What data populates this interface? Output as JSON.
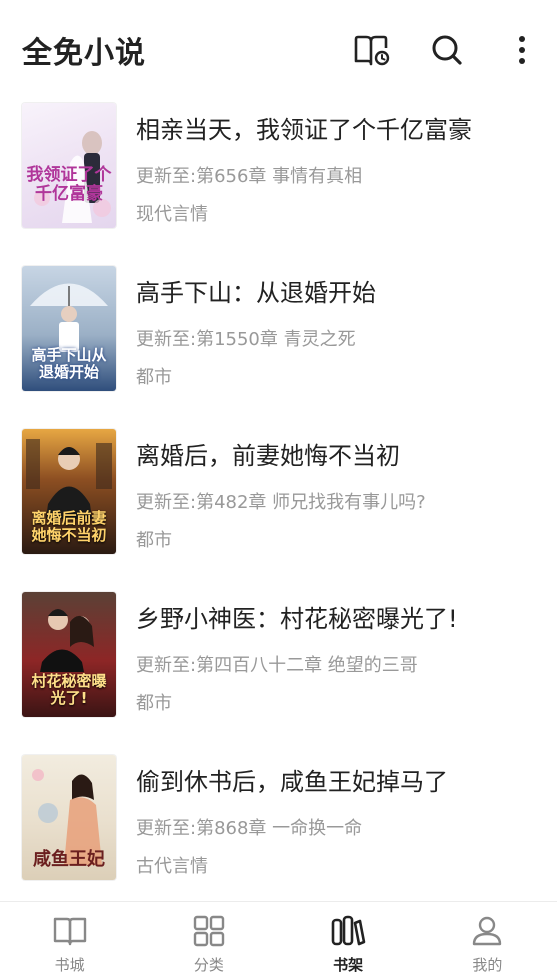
{
  "app": {
    "title": "全免小说"
  },
  "header_icons": [
    "bookshelf-history-icon",
    "search-icon",
    "more-vertical-icon"
  ],
  "books": [
    {
      "title": "相亲当天，我领证了个千亿富豪",
      "update": "更新至:第656章 事情有真相",
      "genre": "现代言情",
      "cover_text": "我领证了个千亿富豪"
    },
    {
      "title": "高手下山：从退婚开始",
      "update": "更新至:第1550章 青灵之死",
      "genre": "都市",
      "cover_text": "高手下山从退婚开始"
    },
    {
      "title": "离婚后，前妻她悔不当初",
      "update": "更新至:第482章 师兄找我有事儿吗?",
      "genre": "都市",
      "cover_text": "离婚后前妻她悔不当初"
    },
    {
      "title": "乡野小神医：村花秘密曝光了!",
      "update": "更新至:第四百八十二章 绝望的三哥",
      "genre": "都市",
      "cover_text": "村花秘密曝光了!"
    },
    {
      "title": "偷到休书后，咸鱼王妃掉马了",
      "update": "更新至:第868章 一命换一命",
      "genre": "古代言情",
      "cover_text": "咸鱼王妃"
    }
  ],
  "tabs": [
    {
      "label": "书城",
      "icon": "book-open-icon",
      "active": false
    },
    {
      "label": "分类",
      "icon": "grid-icon",
      "active": false
    },
    {
      "label": "书架",
      "icon": "bookshelf-icon",
      "active": true
    },
    {
      "label": "我的",
      "icon": "user-icon",
      "active": false
    }
  ],
  "colors": {
    "text_primary": "#222222",
    "text_secondary": "#999999",
    "tab_inactive": "#888888"
  }
}
